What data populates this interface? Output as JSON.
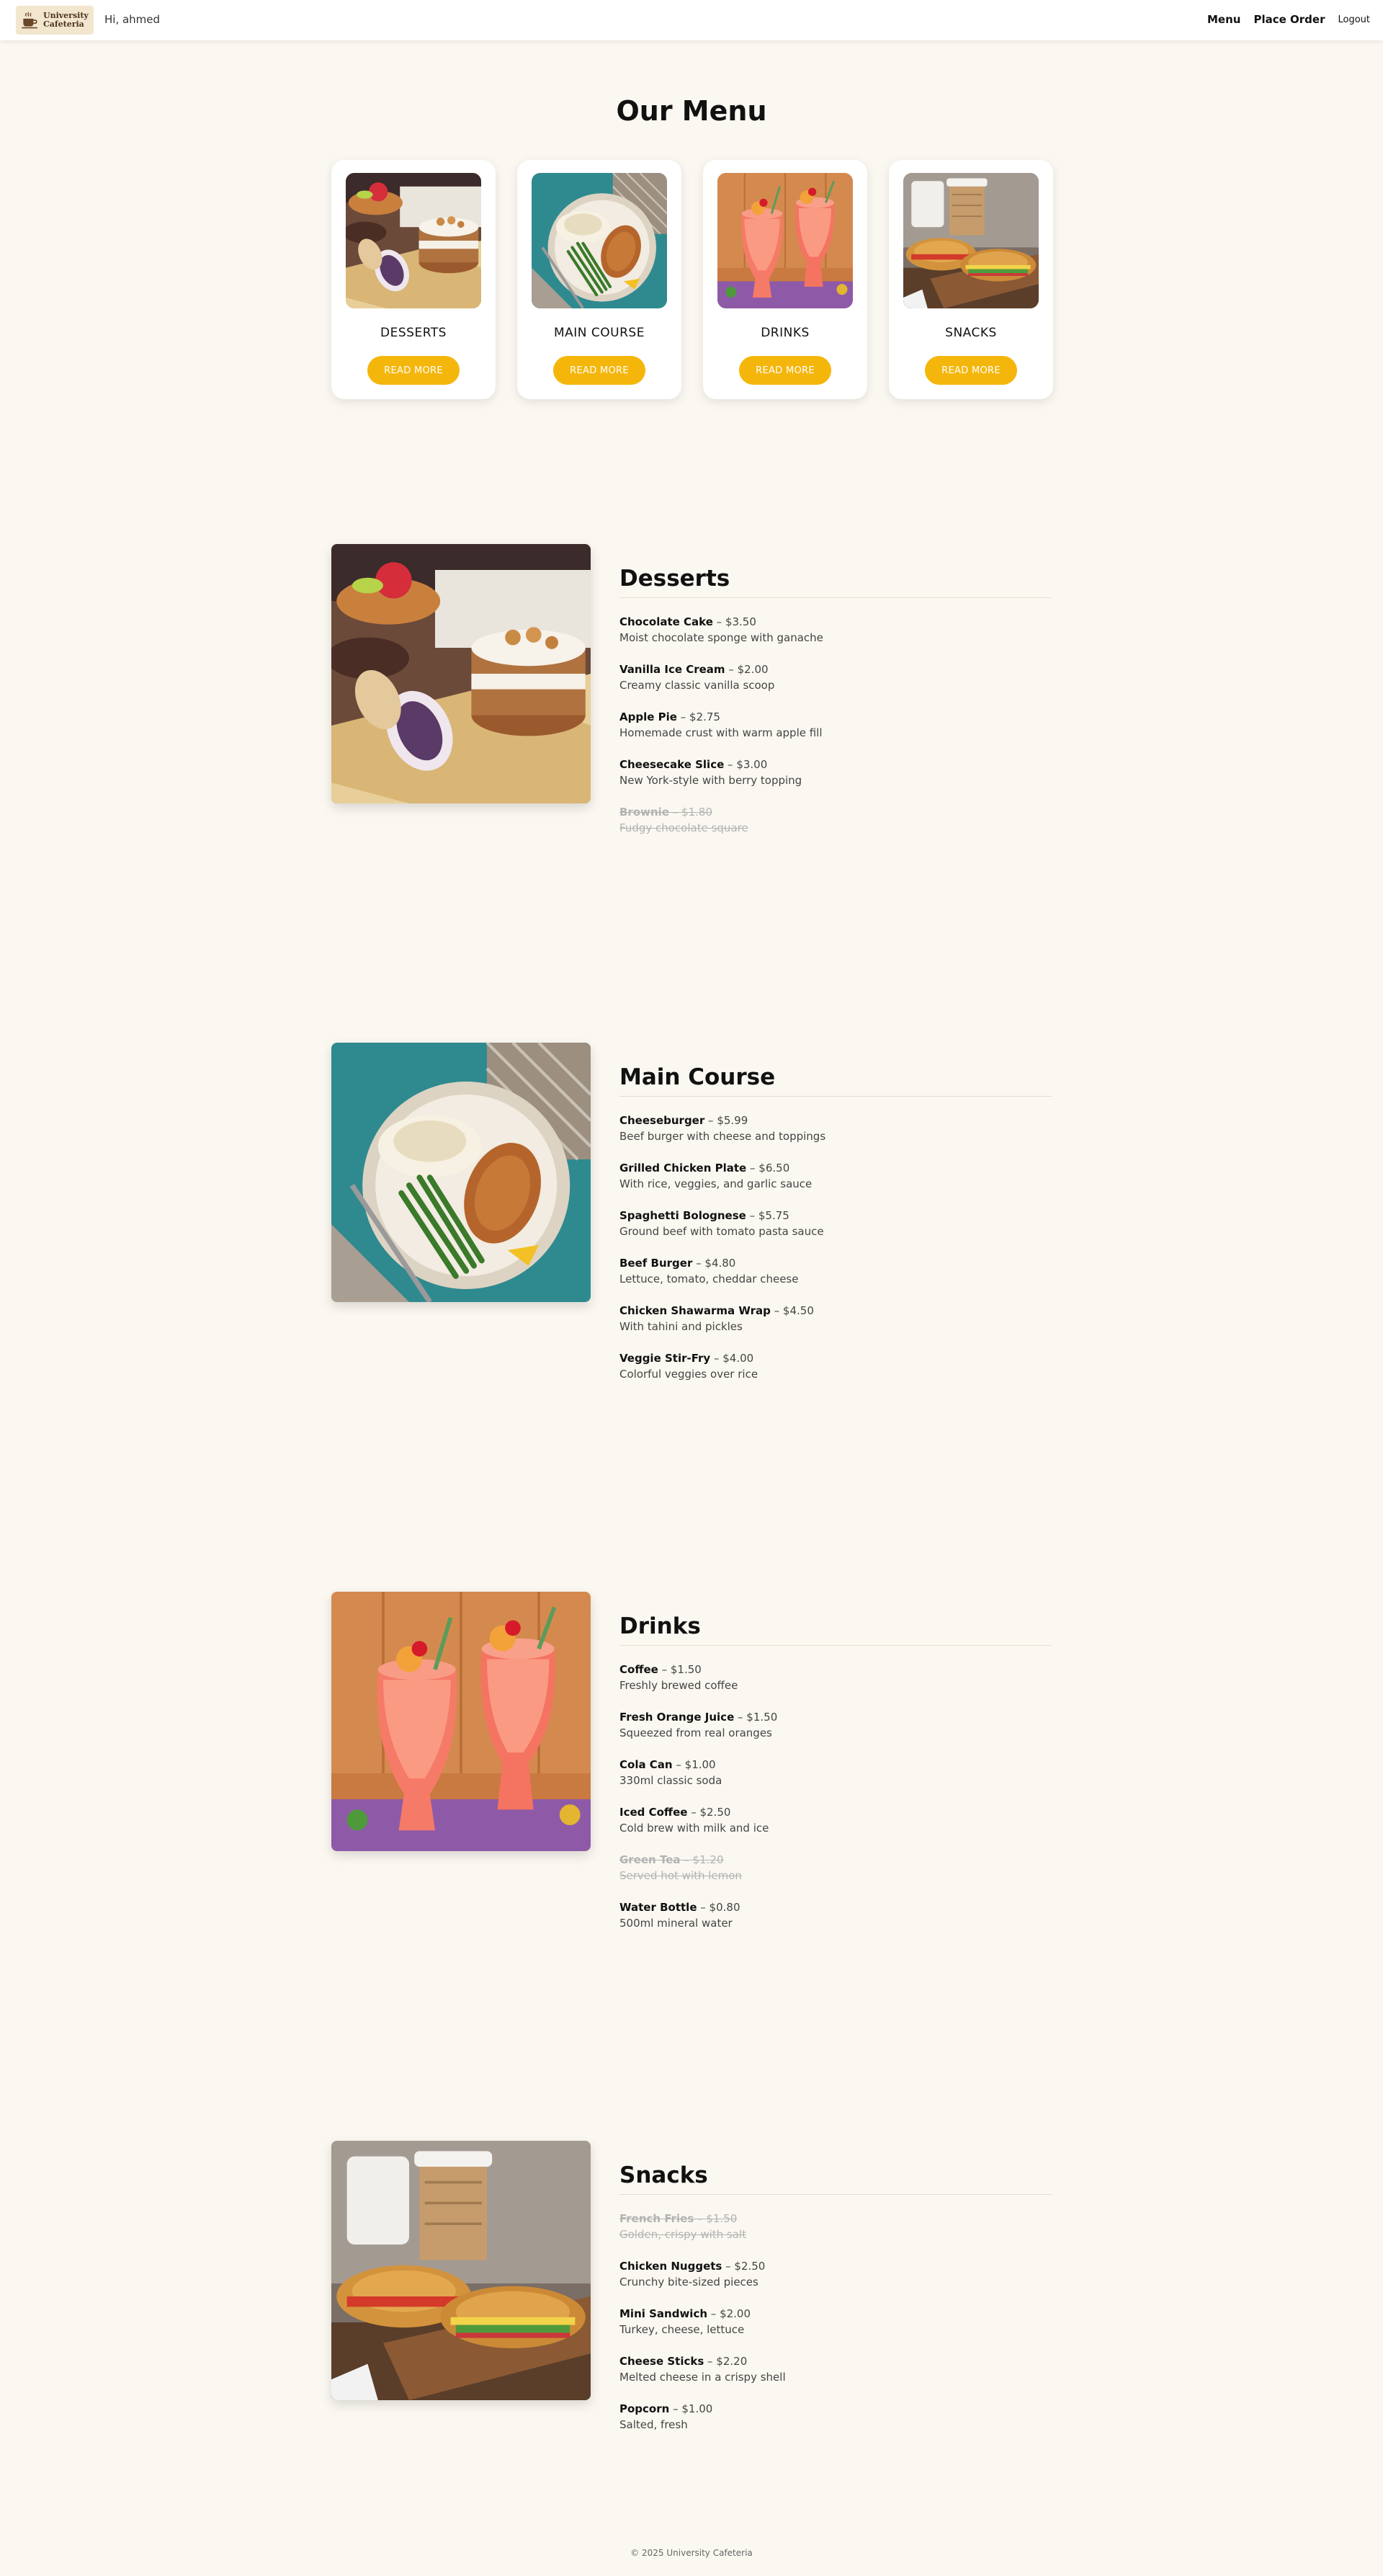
{
  "header": {
    "logo_line1": "University",
    "logo_line2": "Cafeteria",
    "greeting": "Hi, ahmed",
    "nav": {
      "menu": "Menu",
      "place_order": "Place Order",
      "logout": "Logout"
    }
  },
  "page_title": "Our Menu",
  "categories": [
    {
      "name": "DESSERTS",
      "button": "READ MORE"
    },
    {
      "name": "MAIN COURSE",
      "button": "READ MORE"
    },
    {
      "name": "DRINKS",
      "button": "READ MORE"
    },
    {
      "name": "SNACKS",
      "button": "READ MORE"
    }
  ],
  "sections": [
    {
      "title": "Desserts",
      "items": [
        {
          "name": "Chocolate Cake",
          "price": "$3.50",
          "desc": "Moist chocolate sponge with ganache",
          "available": true
        },
        {
          "name": "Vanilla Ice Cream",
          "price": "$2.00",
          "desc": "Creamy classic vanilla scoop",
          "available": true
        },
        {
          "name": "Apple Pie",
          "price": "$2.75",
          "desc": "Homemade crust with warm apple fill",
          "available": true
        },
        {
          "name": "Cheesecake Slice",
          "price": "$3.00",
          "desc": "New York-style with berry topping",
          "available": true
        },
        {
          "name": "Brownie",
          "price": "$1.80",
          "desc": "Fudgy chocolate square",
          "available": false
        }
      ]
    },
    {
      "title": "Main Course",
      "items": [
        {
          "name": "Cheeseburger",
          "price": "$5.99",
          "desc": "Beef burger with cheese and toppings",
          "available": true
        },
        {
          "name": "Grilled Chicken Plate",
          "price": "$6.50",
          "desc": "With rice, veggies, and garlic sauce",
          "available": true
        },
        {
          "name": "Spaghetti Bolognese",
          "price": "$5.75",
          "desc": "Ground beef with tomato pasta sauce",
          "available": true
        },
        {
          "name": "Beef Burger",
          "price": "$4.80",
          "desc": "Lettuce, tomato, cheddar cheese",
          "available": true
        },
        {
          "name": "Chicken Shawarma Wrap",
          "price": "$4.50",
          "desc": "With tahini and pickles",
          "available": true
        },
        {
          "name": "Veggie Stir-Fry",
          "price": "$4.00",
          "desc": "Colorful veggies over rice",
          "available": true
        }
      ]
    },
    {
      "title": "Drinks",
      "items": [
        {
          "name": "Coffee",
          "price": "$1.50",
          "desc": "Freshly brewed coffee",
          "available": true
        },
        {
          "name": "Fresh Orange Juice",
          "price": "$1.50",
          "desc": "Squeezed from real oranges",
          "available": true
        },
        {
          "name": "Cola Can",
          "price": "$1.00",
          "desc": "330ml classic soda",
          "available": true
        },
        {
          "name": "Iced Coffee",
          "price": "$2.50",
          "desc": "Cold brew with milk and ice",
          "available": true
        },
        {
          "name": "Green Tea",
          "price": "$1.20",
          "desc": "Served hot with lemon",
          "available": false
        },
        {
          "name": "Water Bottle",
          "price": "$0.80",
          "desc": "500ml mineral water",
          "available": true
        }
      ]
    },
    {
      "title": "Snacks",
      "items": [
        {
          "name": "French Fries",
          "price": "$1.50",
          "desc": "Golden, crispy with salt",
          "available": false
        },
        {
          "name": "Chicken Nuggets",
          "price": "$2.50",
          "desc": "Crunchy bite-sized pieces",
          "available": true
        },
        {
          "name": "Mini Sandwich",
          "price": "$2.00",
          "desc": "Turkey, cheese, lettuce",
          "available": true
        },
        {
          "name": "Cheese Sticks",
          "price": "$2.20",
          "desc": "Melted cheese in a crispy shell",
          "available": true
        },
        {
          "name": "Popcorn",
          "price": "$1.00",
          "desc": "Salted, fresh",
          "available": true
        }
      ]
    }
  ],
  "footer": "© 2025 University Cafeteria",
  "colors": {
    "accent": "#f5b60b",
    "background": "#fbf8f1"
  }
}
